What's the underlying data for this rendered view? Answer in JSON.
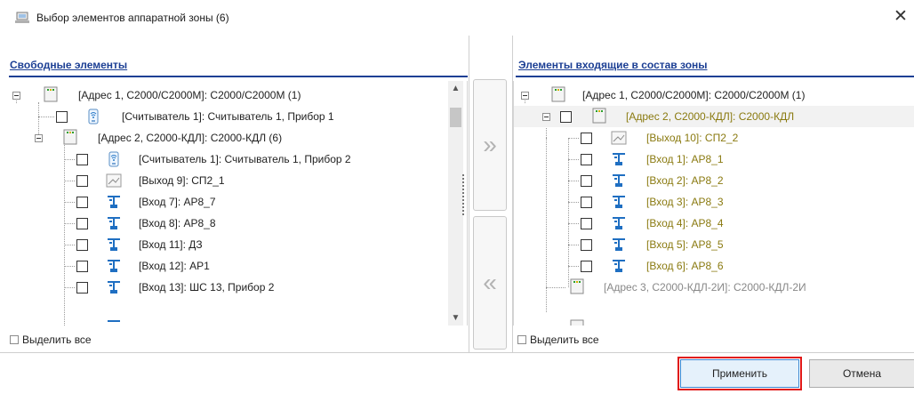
{
  "window": {
    "title": "Выбор элементов аппаратной зоны (6)",
    "close_symbol": "✕"
  },
  "left_pane": {
    "header": "Свободные элементы",
    "select_all_label": "Выделить все",
    "nodes": [
      {
        "label": "[Адрес 1, С2000/С2000М]: С2000/С2000М (1)",
        "icon": "device-panel-icon"
      },
      {
        "label": "[Считыватель 1]: Считыватель 1, Прибор 1",
        "icon": "reader-icon"
      },
      {
        "label": "[Адрес 2, С2000-КДЛ]: С2000-КДЛ (6)",
        "icon": "device-panel-icon"
      },
      {
        "label": "[Считыватель 1]: Считыватель 1, Прибор 2",
        "icon": "reader-icon"
      },
      {
        "label": "[Выход 9]: СП2_1",
        "icon": "output-icon"
      },
      {
        "label": "[Вход 7]: АР8_7",
        "icon": "input-sensor-icon"
      },
      {
        "label": "[Вход 8]: АР8_8",
        "icon": "input-sensor-icon"
      },
      {
        "label": "[Вход 11]: ДЗ",
        "icon": "input-sensor-icon"
      },
      {
        "label": "[Вход 12]: АР1",
        "icon": "input-sensor-icon"
      },
      {
        "label": "[Вход 13]: ШС 13, Прибор 2",
        "icon": "input-sensor-icon"
      }
    ]
  },
  "right_pane": {
    "header": "Элементы входящие в состав зоны",
    "select_all_label": "Выделить все",
    "nodes": [
      {
        "label": "[Адрес 1, С2000/С2000М]: С2000/С2000М (1)",
        "icon": "device-panel-icon"
      },
      {
        "label": "[Адрес 2, С2000-КДЛ]: С2000-КДЛ",
        "icon": "device-panel-icon"
      },
      {
        "label": "[Выход 10]: СП2_2",
        "icon": "output-icon"
      },
      {
        "label": "[Вход 1]: АР8_1",
        "icon": "input-sensor-icon"
      },
      {
        "label": "[Вход 2]: АР8_2",
        "icon": "input-sensor-icon"
      },
      {
        "label": "[Вход 3]: АР8_3",
        "icon": "input-sensor-icon"
      },
      {
        "label": "[Вход 4]: АР8_4",
        "icon": "input-sensor-icon"
      },
      {
        "label": "[Вход 5]: АР8_5",
        "icon": "input-sensor-icon"
      },
      {
        "label": "[Вход 6]: АР8_6",
        "icon": "input-sensor-icon"
      },
      {
        "label": "[Адрес 3, С2000-КДЛ-2И]: С2000-КДЛ-2И",
        "icon": "device-panel-icon"
      }
    ]
  },
  "transfer": {
    "add_symbol": "»",
    "remove_symbol": "«"
  },
  "footer": {
    "apply_label": "Применить",
    "cancel_label": "Отмена"
  },
  "colors": {
    "header_link": "#1c3f94",
    "olive_item": "#8a7a10",
    "highlight_outline": "#e01818"
  }
}
